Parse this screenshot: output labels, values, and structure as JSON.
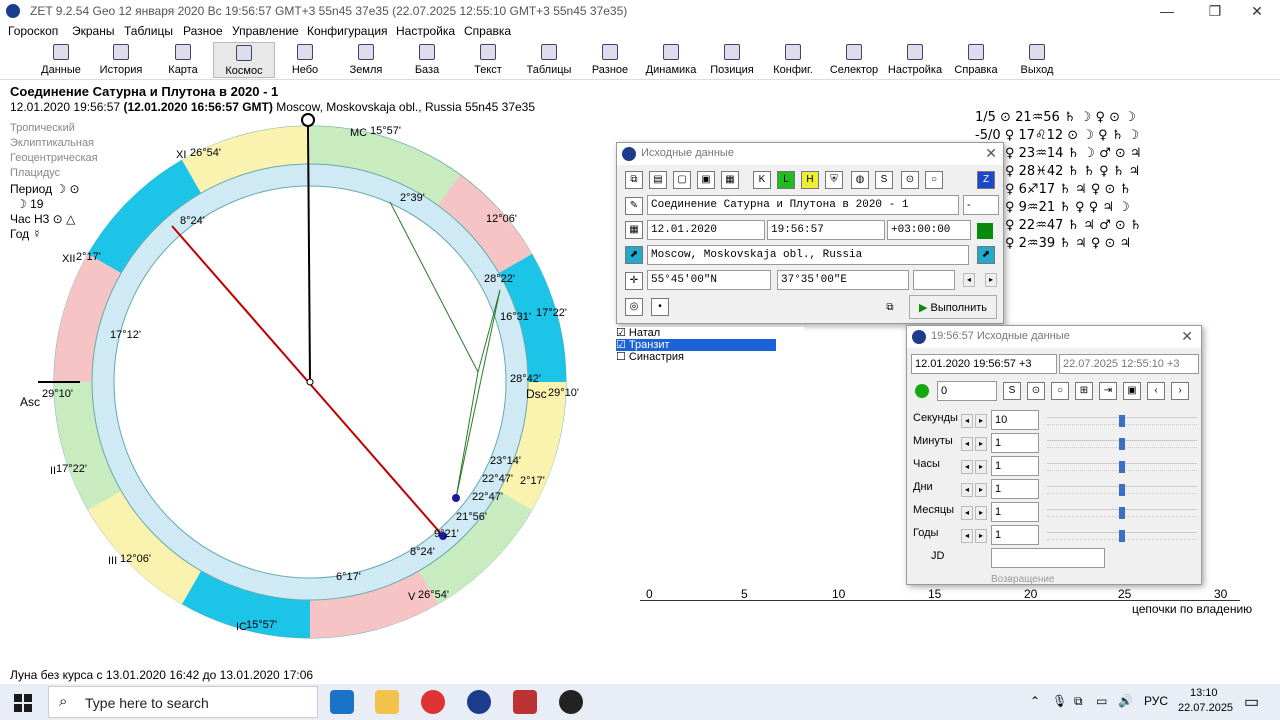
{
  "app": {
    "title": "ZET 9.2.54 Geo   12 января 2020  Вс  19:56:57 GMT+3 55n45 37e35   (22.07.2025  12:55:10 GMT+3 55n45 37e35)"
  },
  "menu": [
    "Гороскоп",
    "Экраны",
    "Таблицы",
    "Разное",
    "Управление",
    "Конфигурация",
    "Настройка",
    "Справка"
  ],
  "toolbar": [
    "Данные",
    "История",
    "Карта",
    "Космос",
    "Небо",
    "Земля",
    "База",
    "Текст",
    "Таблицы",
    "Разное",
    "Динамика",
    "Позиция",
    "Конфиг.",
    "Селектор",
    "Настройка",
    "Справка",
    "Выход"
  ],
  "info": {
    "title": "Соединение Сатурна и Плутона в 2020 - 1",
    "line2_date": "12.01.2020   19:56:57",
    "line2_gmt": "(12.01.2020   16:56:57 GMT)",
    "line2_place": "Moscow, Moskovskaja obl., Russia 55n45  37e35",
    "settings": [
      "Тропический",
      "Эклиптикальная",
      "Геоцентрическая",
      "Плацидус"
    ],
    "period": "Период  ☽ ⊙",
    "period_val": "☽  19",
    "hour": "Час Н3 ⊙ △",
    "year": "Год ☿",
    "bottom": "Луна без курса с 13.01.2020 16:42 до 13.01.2020 17:06"
  },
  "chart": {
    "labels": [
      "15°57'",
      "26°54'",
      "8°24'",
      "2°39'",
      "12°06'",
      "2°17'",
      "28°22'",
      "16°31'",
      "17°22'",
      "17°12'",
      "28°42'",
      "29°10'",
      "29°10'",
      "23°14'",
      "22°47'",
      "22°47'",
      "2°17'",
      "21°56'",
      "9°21'",
      "17°22'",
      "8°24'",
      "12°06'",
      "6°17'",
      "26°54'",
      "15°57'"
    ],
    "asc": "Asc",
    "dsc": "Dsc",
    "houses": [
      "MC",
      "XI",
      "XII",
      "II",
      "III",
      "IC",
      "V"
    ]
  },
  "dialog1": {
    "title": "Исходные данные",
    "name": "Соединение Сатурна и Плутона в 2020 - 1",
    "dash": "-",
    "date": "12.01.2020",
    "time": "19:56:57",
    "tz": "+03:00:00",
    "place": "Moscow, Moskovskaja obl., Russia",
    "lat": "55°45'00\"N",
    "lon": "37°35'00\"E",
    "run": "Выполнить",
    "options": [
      "Натал",
      "Транзит",
      "Синастрия"
    ]
  },
  "dialog2": {
    "title": "19:56:57 Исходные данные",
    "dt1": "12.01.2020  19:56:57  +3",
    "dt2": "22.07.2025    12:55:10  +3",
    "step": "0",
    "rows": [
      {
        "label": "Секунды",
        "value": "10"
      },
      {
        "label": "Минуты",
        "value": "1"
      },
      {
        "label": "Часы",
        "value": "1"
      },
      {
        "label": "Дни",
        "value": "1"
      },
      {
        "label": "Месяцы",
        "value": "1"
      },
      {
        "label": "Годы",
        "value": "1"
      }
    ],
    "jd": "JD",
    "return": "Возвращение"
  },
  "aspects": [
    "1/5    ⊙  21♒56  ♄  ☽  ♀  ⊙  ☽",
    "-5/0   ♀  17♌12  ⊙  ☽  ♀  ♄  ☽",
    "♀  23♒14  ♄  ☽  ♂  ⊙  ♃",
    "♀  28♓42  ♄  ♄  ♀  ♄  ♃",
    "♀  6♐17  ♄  ♃  ♀  ⊙  ♄",
    "♀  9♒21  ♄  ♀  ♀  ♃  ☽",
    "♀  22♒47  ♄  ♃  ♂  ⊙  ♄",
    "♀  2♒39  ♄  ♃  ♀  ⊙  ♃"
  ],
  "axis": {
    "ticks": [
      "0",
      "5",
      "10",
      "15",
      "20",
      "25",
      "30"
    ],
    "caption": "цепочки по владению"
  },
  "taskbar": {
    "search": "Type here to search",
    "lang": "РУС",
    "time": "13:10",
    "date": "22.07.2025"
  }
}
